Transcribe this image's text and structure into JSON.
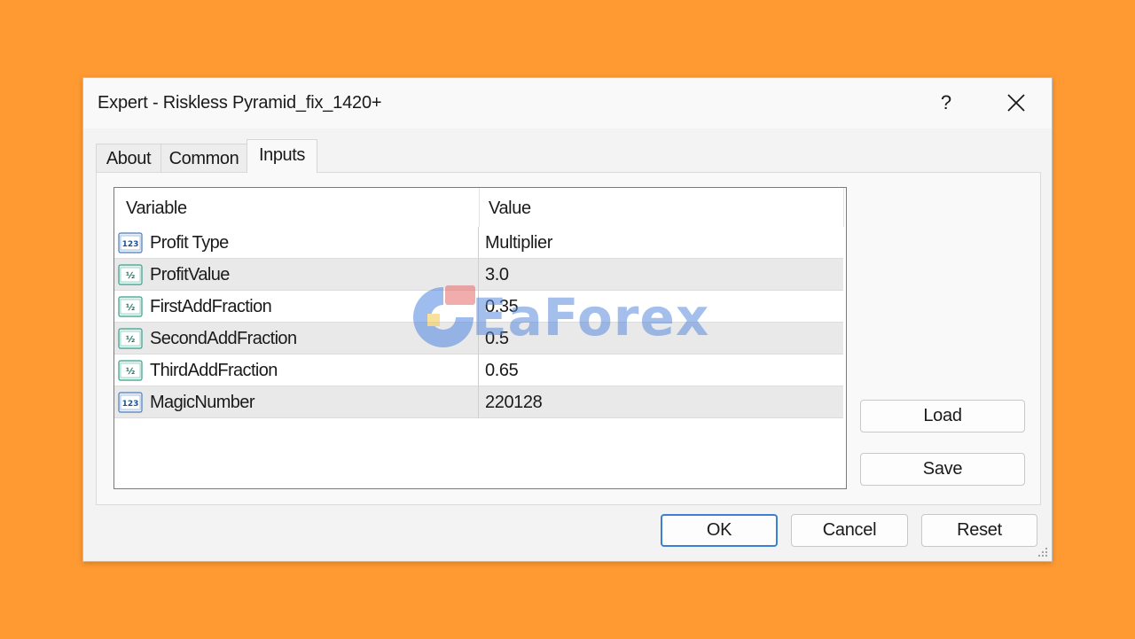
{
  "window": {
    "title": "Expert - Riskless Pyramid_fix_1420+",
    "help_label": "?",
    "close_icon": "close-icon"
  },
  "tabs": [
    {
      "label": "About",
      "active": false
    },
    {
      "label": "Common",
      "active": false
    },
    {
      "label": "Inputs",
      "active": true
    }
  ],
  "grid": {
    "columns": [
      "Variable",
      "Value"
    ],
    "rows": [
      {
        "icon": "integer-type-icon",
        "variable": "Profit Type",
        "value": "Multiplier"
      },
      {
        "icon": "double-type-icon",
        "variable": "ProfitValue",
        "value": "3.0"
      },
      {
        "icon": "double-type-icon",
        "variable": "FirstAddFraction",
        "value": "0.35"
      },
      {
        "icon": "double-type-icon",
        "variable": "SecondAddFraction",
        "value": "0.5"
      },
      {
        "icon": "double-type-icon",
        "variable": "ThirdAddFraction",
        "value": "0.65"
      },
      {
        "icon": "integer-type-icon",
        "variable": "MagicNumber",
        "value": "220128"
      }
    ]
  },
  "side_buttons": {
    "load_label": "Load",
    "save_label": "Save"
  },
  "footer_buttons": {
    "ok_label": "OK",
    "cancel_label": "Cancel",
    "reset_label": "Reset"
  },
  "watermark": {
    "text": "EaForex"
  },
  "colors": {
    "background": "#FF9A33",
    "accent": "#3D7FD0",
    "row_alt": "#E9E9E9"
  }
}
